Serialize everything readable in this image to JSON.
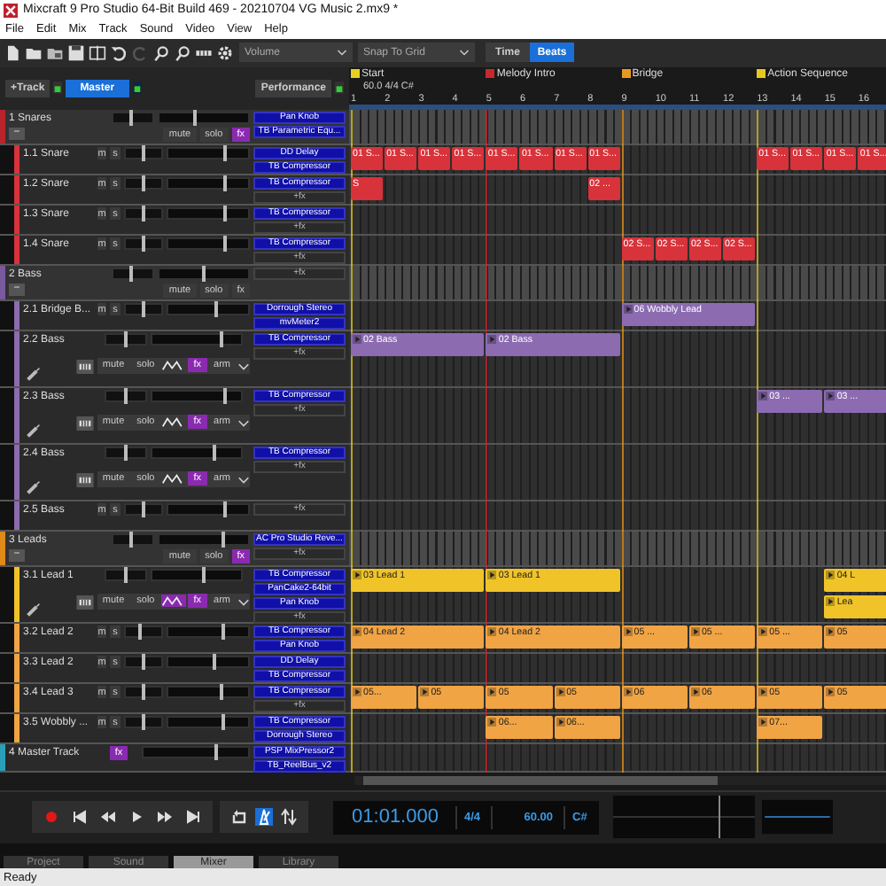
{
  "window": {
    "title": "Mixcraft 9 Pro Studio 64-Bit Build 469 - 20210704 VG Music 2.mx9 *"
  },
  "menu": [
    "File",
    "Edit",
    "Mix",
    "Track",
    "Sound",
    "Video",
    "View",
    "Help"
  ],
  "toolbar": {
    "redo_disabled": true,
    "volume_dropdown": "Volume",
    "snap_dropdown": "Snap To Grid",
    "time_modes": [
      {
        "label": "Time",
        "selected": false
      },
      {
        "label": "Beats",
        "selected": true
      }
    ]
  },
  "header": {
    "add_track": "+Track",
    "master": "Master",
    "performance": "Performance"
  },
  "ruler": {
    "bars": [
      {
        "label": "1",
        "marker": {
          "label": "Start",
          "color": "#e8d020",
          "detail": "60.0 4/4 C#"
        }
      },
      {
        "label": "2"
      },
      {
        "label": "3"
      },
      {
        "label": "4"
      },
      {
        "label": "5",
        "marker": {
          "label": "Melody Intro",
          "color": "#c8282c"
        }
      },
      {
        "label": "6"
      },
      {
        "label": "7"
      },
      {
        "label": "8"
      },
      {
        "label": "9",
        "marker": {
          "label": "Bridge",
          "color": "#e89a20"
        }
      },
      {
        "label": "10"
      },
      {
        "label": "11"
      },
      {
        "label": "12"
      },
      {
        "label": "13",
        "marker": {
          "label": "Action Sequence",
          "color": "#e8c820"
        }
      },
      {
        "label": "14"
      },
      {
        "label": "15"
      },
      {
        "label": "16"
      }
    ]
  },
  "tracks": [
    {
      "name": "1 Snares",
      "kind": "group",
      "color": "#b8242c",
      "pan": {
        "level": 0.45
      },
      "volume": {
        "level": 0.4
      },
      "collapse": "−",
      "buttons": [
        {
          "label": "mute",
          "on": false
        },
        {
          "label": "solo",
          "on": false
        },
        {
          "label": "fx",
          "on": true
        }
      ],
      "fx": [
        "Pan Knob",
        "TB Parametric Equ..."
      ],
      "children": [
        {
          "name": "1.1 Snare",
          "kind": "track",
          "color": "#d8323a",
          "pan": {
            "level": 0.5
          },
          "volume": {
            "level": 0.72
          },
          "buttons": [
            {
              "label": "m",
              "on": false
            },
            {
              "label": "s",
              "on": false
            }
          ],
          "fx": [
            "DD Delay",
            "TB Compressor"
          ],
          "lanes": [
            [
              {
                "kind": "clip",
                "label": "01 S..."
              },
              {
                "kind": "clip",
                "label": "01 S..."
              },
              {
                "kind": "clip",
                "label": "01 S..."
              },
              {
                "kind": "clip",
                "label": "01 S..."
              },
              {
                "kind": "clip",
                "label": "01 S..."
              },
              {
                "kind": "clip",
                "label": "01 S..."
              },
              {
                "kind": "clip",
                "label": "01 S..."
              },
              {
                "kind": "clip",
                "label": "01 S..."
              },
              {
                "kind": "empty"
              },
              {
                "kind": "empty"
              },
              {
                "kind": "empty"
              },
              {
                "kind": "empty"
              },
              {
                "kind": "clip",
                "label": "01 S..."
              },
              {
                "kind": "clip",
                "label": "01 S..."
              },
              {
                "kind": "clip",
                "label": "01 S..."
              },
              {
                "kind": "clip",
                "label": "01 S..."
              }
            ]
          ]
        },
        {
          "name": "1.2 Snare",
          "kind": "track",
          "color": "#d8323a",
          "pan": {
            "level": 0.5
          },
          "volume": {
            "level": 0.72
          },
          "buttons": [
            {
              "label": "m",
              "on": false
            },
            {
              "label": "s",
              "on": false
            }
          ],
          "fx": [
            "TB Compressor"
          ],
          "add_fx": "+fx",
          "lanes": [
            [
              {
                "kind": "clip",
                "label": "S"
              },
              {
                "kind": "empty"
              },
              {
                "kind": "empty"
              },
              {
                "kind": "empty"
              },
              {
                "kind": "empty"
              },
              {
                "kind": "empty"
              },
              {
                "kind": "empty"
              },
              {
                "kind": "clip",
                "label": "02 ..."
              }
            ]
          ]
        },
        {
          "name": "1.3 Snare",
          "kind": "track",
          "color": "#d8323a",
          "pan": {
            "level": 0.5
          },
          "volume": {
            "level": 0.72
          },
          "buttons": [
            {
              "label": "m",
              "on": false
            },
            {
              "label": "s",
              "on": false
            }
          ],
          "fx": [
            "TB Compressor"
          ],
          "add_fx": "+fx"
        },
        {
          "name": "1.4 Snare",
          "kind": "track",
          "color": "#d8323a",
          "pan": {
            "level": 0.5
          },
          "volume": {
            "level": 0.72
          },
          "buttons": [
            {
              "label": "m",
              "on": false
            },
            {
              "label": "s",
              "on": false
            }
          ],
          "fx": [
            "TB Compressor"
          ],
          "add_fx": "+fx",
          "lanes": [
            [
              {
                "kind": "empty"
              },
              {
                "kind": "empty"
              },
              {
                "kind": "empty"
              },
              {
                "kind": "empty"
              },
              {
                "kind": "empty"
              },
              {
                "kind": "empty"
              },
              {
                "kind": "empty"
              },
              {
                "kind": "empty"
              },
              {
                "kind": "clip",
                "label": "02 S..."
              },
              {
                "kind": "clip",
                "label": "02 S..."
              },
              {
                "kind": "clip",
                "label": "02 S..."
              },
              {
                "kind": "clip",
                "label": "02 S..."
              }
            ]
          ]
        }
      ]
    },
    {
      "name": "2 Bass",
      "kind": "group",
      "color": "#7a5a9e",
      "pan": {
        "level": 0.45
      },
      "volume": {
        "level": 0.5
      },
      "collapse": "−",
      "buttons": [
        {
          "label": "mute",
          "on": false
        },
        {
          "label": "solo",
          "on": false
        },
        {
          "label": "fx",
          "on": false
        }
      ],
      "add_fx": "+fx",
      "children": [
        {
          "name": "2.1 Bridge B...",
          "kind": "track",
          "color": "#8c6bb1",
          "pan": {
            "level": 0.5
          },
          "volume": {
            "level": 0.6
          },
          "buttons": [
            {
              "label": "m",
              "on": false
            },
            {
              "label": "s",
              "on": false
            }
          ],
          "fx": [
            "Dorrough Stereo",
            "mvMeter2"
          ],
          "lanes": [
            [
              {
                "kind": "empty"
              },
              {
                "kind": "empty"
              },
              {
                "kind": "empty"
              },
              {
                "kind": "empty"
              },
              {
                "kind": "empty"
              },
              {
                "kind": "empty"
              },
              {
                "kind": "empty"
              },
              {
                "kind": "empty"
              },
              {
                "kind": "clip",
                "label": "06 Wobbly Lead"
              },
              {
                "kind": "more"
              },
              {
                "kind": "more"
              },
              {
                "kind": "more"
              }
            ]
          ]
        },
        {
          "name": "2.2 Bass",
          "kind": "expanded",
          "color": "#8c6bb1",
          "pan": {
            "level": 0.5
          },
          "volume": {
            "level": 0.77
          },
          "buttons": [
            {
              "label": "mute",
              "on": false
            },
            {
              "label": "solo",
              "on": false
            },
            {
              "label": "fx",
              "on": true
            },
            {
              "label": "arm",
              "on": false
            }
          ],
          "envelope_on": false,
          "fx": [
            "TB Compressor"
          ],
          "add_fx": "+fx",
          "lanes": [
            [
              {
                "kind": "clip",
                "label": "02 Bass"
              },
              {
                "kind": "more"
              },
              {
                "kind": "more"
              },
              {
                "kind": "more"
              },
              {
                "kind": "clip",
                "label": "02 Bass"
              },
              {
                "kind": "more"
              },
              {
                "kind": "more"
              },
              {
                "kind": "more"
              }
            ]
          ]
        },
        {
          "name": "2.3 Bass",
          "kind": "expanded",
          "color": "#8c6bb1",
          "pan": {
            "level": 0.5
          },
          "volume": {
            "level": 0.82
          },
          "buttons": [
            {
              "label": "mute",
              "on": false
            },
            {
              "label": "solo",
              "on": false
            },
            {
              "label": "fx",
              "on": true
            },
            {
              "label": "arm",
              "on": false
            }
          ],
          "envelope_on": false,
          "fx": [
            "TB Compressor"
          ],
          "add_fx": "+fx",
          "lanes": [
            [
              {
                "kind": "empty"
              },
              {
                "kind": "empty"
              },
              {
                "kind": "empty"
              },
              {
                "kind": "empty"
              },
              {
                "kind": "empty"
              },
              {
                "kind": "empty"
              },
              {
                "kind": "empty"
              },
              {
                "kind": "empty"
              },
              {
                "kind": "empty"
              },
              {
                "kind": "empty"
              },
              {
                "kind": "empty"
              },
              {
                "kind": "empty"
              },
              {
                "kind": "clip",
                "label": "03 ..."
              },
              {
                "kind": "more"
              },
              {
                "kind": "clip",
                "label": "03 ..."
              },
              {
                "kind": "more"
              }
            ]
          ]
        },
        {
          "name": "2.4 Bass",
          "kind": "expanded",
          "color": "#8c6bb1",
          "pan": {
            "level": 0.5
          },
          "volume": {
            "level": 0.7
          },
          "buttons": [
            {
              "label": "mute",
              "on": false
            },
            {
              "label": "solo",
              "on": false
            },
            {
              "label": "fx",
              "on": true
            },
            {
              "label": "arm",
              "on": false
            }
          ],
          "envelope_on": false,
          "fx": [
            "TB Compressor"
          ],
          "add_fx": "+fx"
        },
        {
          "name": "2.5 Bass",
          "kind": "track",
          "color": "#8c6bb1",
          "pan": {
            "level": 0.5
          },
          "volume": {
            "level": 0.72
          },
          "buttons": [
            {
              "label": "m",
              "on": false
            },
            {
              "label": "s",
              "on": false
            }
          ],
          "add_fx": "+fx"
        }
      ]
    },
    {
      "name": "3 Leads",
      "kind": "group",
      "color": "#e08a1a",
      "pan": {
        "level": 0.45
      },
      "volume": {
        "level": 0.72
      },
      "collapse": "−",
      "buttons": [
        {
          "label": "mute",
          "on": false
        },
        {
          "label": "solo",
          "on": false
        },
        {
          "label": "fx",
          "on": true
        }
      ],
      "fx": [
        "AC Pro Studio Reve..."
      ],
      "add_fx": "+fx",
      "children": [
        {
          "name": "3.1 Lead 1",
          "kind": "expanded",
          "color": "#f0c428",
          "pan": {
            "level": 0.5
          },
          "volume": {
            "level": 0.57
          },
          "buttons": [
            {
              "label": "mute",
              "on": false
            },
            {
              "label": "solo",
              "on": false
            },
            {
              "label": "fx",
              "on": true
            },
            {
              "label": "arm",
              "on": false
            }
          ],
          "envelope_on": true,
          "fx": [
            "TB Compressor",
            "PanCake2-64bit",
            "Pan Knob"
          ],
          "add_fx": "+fx",
          "lanes": [
            [
              {
                "kind": "clip",
                "label": "03 Lead 1"
              },
              {
                "kind": "more"
              },
              {
                "kind": "more"
              },
              {
                "kind": "more"
              },
              {
                "kind": "clip",
                "label": "03 Lead 1"
              },
              {
                "kind": "more"
              },
              {
                "kind": "more"
              },
              {
                "kind": "more"
              },
              {
                "kind": "empty"
              },
              {
                "kind": "empty"
              },
              {
                "kind": "empty"
              },
              {
                "kind": "empty"
              },
              {
                "kind": "empty"
              },
              {
                "kind": "empty"
              },
              {
                "kind": "clip",
                "label": "04 L"
              },
              {
                "kind": "more"
              }
            ],
            [
              {
                "kind": "empty"
              },
              {
                "kind": "empty"
              },
              {
                "kind": "empty"
              },
              {
                "kind": "empty"
              },
              {
                "kind": "empty"
              },
              {
                "kind": "empty"
              },
              {
                "kind": "empty"
              },
              {
                "kind": "empty"
              },
              {
                "kind": "empty"
              },
              {
                "kind": "empty"
              },
              {
                "kind": "empty"
              },
              {
                "kind": "empty"
              },
              {
                "kind": "empty"
              },
              {
                "kind": "empty"
              },
              {
                "kind": "clip",
                "label": "Lea"
              },
              {
                "kind": "more"
              }
            ]
          ]
        },
        {
          "name": "3.2 Lead 2",
          "kind": "track",
          "color": "#f0a444",
          "pan": {
            "level": 0.4
          },
          "volume": {
            "level": 0.68
          },
          "buttons": [
            {
              "label": "m",
              "on": false
            },
            {
              "label": "s",
              "on": false
            }
          ],
          "fx": [
            "TB Compressor",
            "Pan Knob"
          ],
          "lanes": [
            [
              {
                "kind": "clip",
                "label": "04 Lead 2"
              },
              {
                "kind": "more"
              },
              {
                "kind": "more"
              },
              {
                "kind": "more"
              },
              {
                "kind": "clip",
                "label": "04 Lead 2"
              },
              {
                "kind": "more"
              },
              {
                "kind": "more"
              },
              {
                "kind": "more"
              },
              {
                "kind": "clip",
                "label": "05 ..."
              },
              {
                "kind": "more"
              },
              {
                "kind": "clip",
                "label": "05 ..."
              },
              {
                "kind": "more"
              },
              {
                "kind": "clip",
                "label": "05 ..."
              },
              {
                "kind": "more"
              },
              {
                "kind": "clip",
                "label": "05"
              },
              {
                "kind": "more"
              }
            ]
          ]
        },
        {
          "name": "3.3 Lead 2",
          "kind": "track",
          "color": "#f0a444",
          "pan": {
            "level": 0.5
          },
          "volume": {
            "level": 0.57
          },
          "buttons": [
            {
              "label": "m",
              "on": false
            },
            {
              "label": "s",
              "on": false
            }
          ],
          "fx": [
            "DD Delay",
            "TB Compressor"
          ]
        },
        {
          "name": "3.4 Lead 3",
          "kind": "track",
          "color": "#f0a444",
          "pan": {
            "level": 0.5
          },
          "volume": {
            "level": 0.66
          },
          "buttons": [
            {
              "label": "m",
              "on": false
            },
            {
              "label": "s",
              "on": false
            }
          ],
          "fx": [
            "TB Compressor"
          ],
          "add_fx": "+fx",
          "lanes": [
            [
              {
                "kind": "clip",
                "label": "05..."
              },
              {
                "kind": "more"
              },
              {
                "kind": "clip",
                "label": "05"
              },
              {
                "kind": "more"
              },
              {
                "kind": "clip",
                "label": "05"
              },
              {
                "kind": "more"
              },
              {
                "kind": "clip",
                "label": "05"
              },
              {
                "kind": "more"
              },
              {
                "kind": "clip",
                "label": "06"
              },
              {
                "kind": "more"
              },
              {
                "kind": "clip",
                "label": "06"
              },
              {
                "kind": "more"
              },
              {
                "kind": "clip",
                "label": "05"
              },
              {
                "kind": "more"
              },
              {
                "kind": "clip",
                "label": "05"
              },
              {
                "kind": "more"
              }
            ]
          ]
        },
        {
          "name": "3.5 Wobbly ...",
          "kind": "track",
          "color": "#f0a444",
          "pan": {
            "level": 0.5
          },
          "volume": {
            "level": 0.7
          },
          "buttons": [
            {
              "label": "m",
              "on": false
            },
            {
              "label": "s",
              "on": false
            }
          ],
          "fx": [
            "TB Compressor",
            "Dorrough Stereo"
          ],
          "lanes": [
            [
              {
                "kind": "empty"
              },
              {
                "kind": "empty"
              },
              {
                "kind": "empty"
              },
              {
                "kind": "empty"
              },
              {
                "kind": "clip",
                "label": "06..."
              },
              {
                "kind": "more"
              },
              {
                "kind": "clip",
                "label": "06..."
              },
              {
                "kind": "more"
              },
              {
                "kind": "empty"
              },
              {
                "kind": "empty"
              },
              {
                "kind": "empty"
              },
              {
                "kind": "empty"
              },
              {
                "kind": "clip",
                "label": "07..."
              },
              {
                "kind": "more"
              }
            ]
          ]
        }
      ]
    },
    {
      "name": "4 Master Track",
      "kind": "master",
      "color": "#2aa0b8",
      "volume": {
        "level": 0.7
      },
      "buttons": [
        {
          "label": "fx",
          "on": true
        }
      ],
      "fx": [
        "PSP MixPressor2",
        "TB_ReelBus_v2"
      ]
    }
  ],
  "transport": {
    "loop_on": false,
    "metronome_on": true,
    "time": "01:01.000",
    "signature": "4/4",
    "tempo": "60.00",
    "key": "C#"
  },
  "tabs": [
    {
      "label": "Project",
      "selected": false
    },
    {
      "label": "Sound",
      "selected": false
    },
    {
      "label": "Mixer",
      "selected": true
    },
    {
      "label": "Library",
      "selected": false
    }
  ],
  "status": "Ready"
}
